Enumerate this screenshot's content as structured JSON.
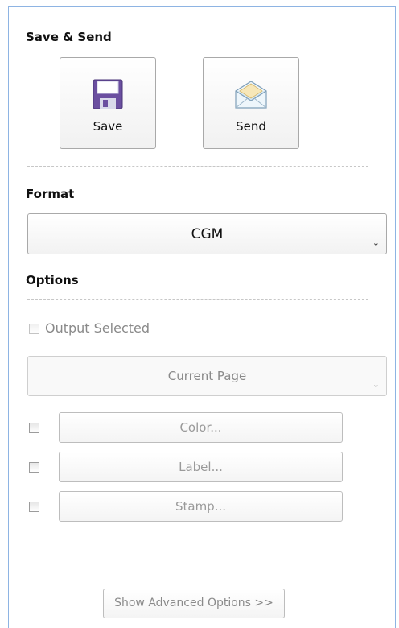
{
  "save_send": {
    "heading": "Save & Send",
    "save_label": "Save",
    "send_label": "Send",
    "save_icon": "floppy-disk-icon",
    "send_icon": "envelope-icon"
  },
  "format": {
    "heading": "Format",
    "selected": "CGM",
    "arrow": "⌄"
  },
  "options": {
    "heading": "Options",
    "output_selected_label": "Output Selected",
    "output_selected_checked": false,
    "page_range_selected": "Current Page",
    "color_button": "Color...",
    "label_button": "Label...",
    "stamp_button": "Stamp...",
    "advanced_button": "Show Advanced Options >>"
  },
  "colors": {
    "panel_border": "#8eb4e3",
    "floppy_body": "#6b4fa0"
  }
}
